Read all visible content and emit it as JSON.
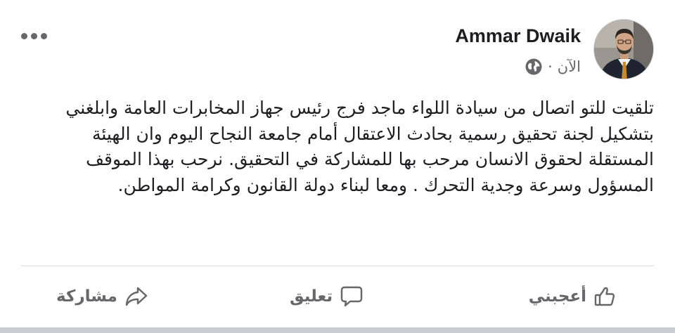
{
  "post": {
    "author": "Ammar Dwaik",
    "timestamp": "الآن",
    "separator": "·",
    "privacy_icon": "globe-icon",
    "more_icon": "more-options-icon",
    "text": "تلقيت للتو اتصال من سيادة اللواء ماجد فرج رئيس جهاز المخابرات العامة وابلغني بتشكيل لجنة تحقيق رسمية بحادث الاعتقال أمام جامعة النجاح اليوم وان الهيئة المستقلة لحقوق الانسان مرحب بها للمشاركة في التحقيق. نرحب بهذا الموقف المسؤول وسرعة وجدية التحرك . ومعا لبناء دولة القانون وكرامة المواطن."
  },
  "actions": {
    "like_label": "أعجبني",
    "comment_label": "تعليق",
    "share_label": "مشاركة"
  },
  "colors": {
    "text": "#1c1e21",
    "secondary": "#65676b",
    "divider": "#dadde1"
  }
}
